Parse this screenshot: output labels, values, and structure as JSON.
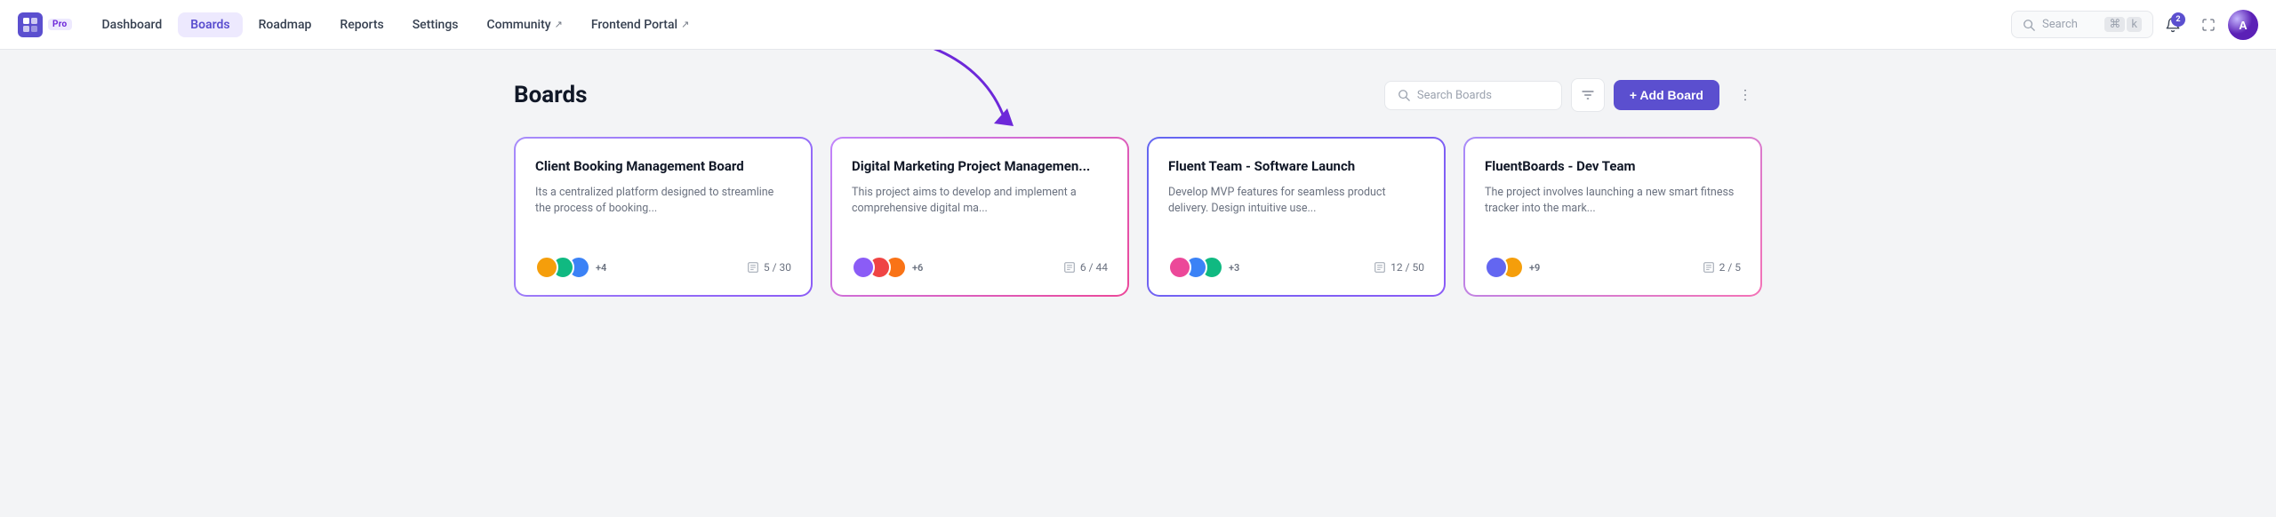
{
  "nav": {
    "logo_label": "Pro",
    "items": [
      {
        "id": "dashboard",
        "label": "Dashboard",
        "active": false,
        "external": false
      },
      {
        "id": "boards",
        "label": "Boards",
        "active": true,
        "external": false
      },
      {
        "id": "roadmap",
        "label": "Roadmap",
        "active": false,
        "external": false
      },
      {
        "id": "reports",
        "label": "Reports",
        "active": false,
        "external": false
      },
      {
        "id": "settings",
        "label": "Settings",
        "active": false,
        "external": false
      },
      {
        "id": "community",
        "label": "Community",
        "active": false,
        "external": true
      },
      {
        "id": "frontend-portal",
        "label": "Frontend Portal",
        "active": false,
        "external": true
      }
    ],
    "search": {
      "placeholder": "Search",
      "kbd1": "⌘",
      "kbd2": "k"
    },
    "notifications_count": "2"
  },
  "page": {
    "title": "Boards",
    "search_placeholder": "Search Boards",
    "add_board_label": "+ Add Board",
    "more_label": "⋯"
  },
  "boards": [
    {
      "id": "board-1",
      "title": "Client Booking Management Board",
      "description": "Its a centralized platform designed to streamline the process of booking...",
      "avatars": [
        "#f59e0b",
        "#10b981",
        "#3b82f6"
      ],
      "extra_members": "+4",
      "tasks_done": "5",
      "tasks_total": "30",
      "border_style": "gradient-1"
    },
    {
      "id": "board-2",
      "title": "Digital Marketing Project Managemen...",
      "description": "This project aims to develop and implement a comprehensive digital ma...",
      "avatars": [
        "#8b5cf6",
        "#ef4444",
        "#f97316"
      ],
      "extra_members": "+6",
      "tasks_done": "6",
      "tasks_total": "44",
      "border_style": "gradient-2"
    },
    {
      "id": "board-3",
      "title": "Fluent Team - Software Launch",
      "description": "Develop MVP features for seamless product delivery. Design intuitive use...",
      "avatars": [
        "#ec4899",
        "#3b82f6",
        "#10b981"
      ],
      "extra_members": "+3",
      "tasks_done": "12",
      "tasks_total": "50",
      "border_style": "gradient-3"
    },
    {
      "id": "board-4",
      "title": "FluentBoards - Dev Team",
      "description": "The project involves launching a new smart fitness tracker into the mark...",
      "avatars": [
        "#6366f1",
        "#f59e0b"
      ],
      "extra_members": "+9",
      "tasks_done": "2",
      "tasks_total": "5",
      "border_style": "gradient-4"
    }
  ]
}
